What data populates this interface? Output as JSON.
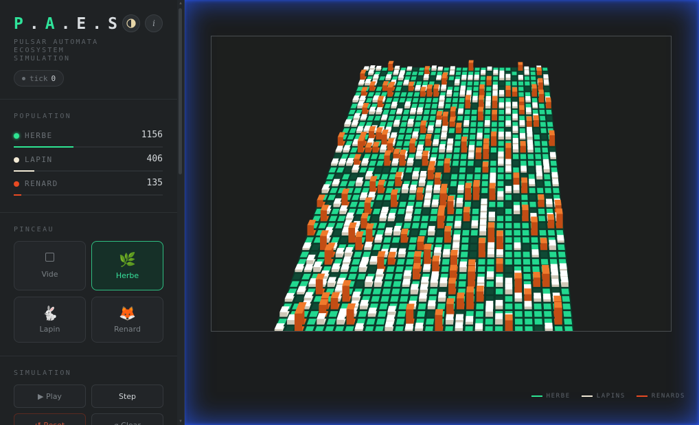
{
  "app": {
    "logo_p": "P",
    "logo_dot1": ".",
    "logo_a": "A",
    "logo_rest": ".E.S.",
    "subtitle": "PULSAR AUTOMATA ECOSYSTEM SIMULATION",
    "theme_icon": "half-moon-icon",
    "info_label": "i",
    "tick_label": "tick",
    "tick_value": "0"
  },
  "population": {
    "title": "POPULATION",
    "rows": [
      {
        "label": "HERBE",
        "value": "1156",
        "color": "#2ee592",
        "fill": 0.4
      },
      {
        "label": "LAPIN",
        "value": "406",
        "color": "#f2ead6",
        "fill": 0.14
      },
      {
        "label": "RENARD",
        "value": "135",
        "color": "#e84a22",
        "fill": 0.05
      }
    ]
  },
  "brush": {
    "title": "PINCEAU",
    "items": [
      {
        "label": "Vide",
        "icon": "square-icon",
        "active": false
      },
      {
        "label": "Herbe",
        "icon": "leaf-icon",
        "glyph": "🌿",
        "active": true
      },
      {
        "label": "Lapin",
        "icon": "rabbit-icon",
        "glyph": "🐇",
        "active": false
      },
      {
        "label": "Renard",
        "icon": "fox-icon",
        "glyph": "🦊",
        "active": false
      }
    ]
  },
  "simulation": {
    "title": "SIMULATION",
    "play_label": "▶ Play",
    "step_label": "Step",
    "reset_label": "↺ Reset",
    "clear_label": "⌀ Clear"
  },
  "legend": [
    {
      "label": "HERBE",
      "color": "#2ee592"
    },
    {
      "label": "LAPINS",
      "color": "#f2ead6"
    },
    {
      "label": "RENARDS",
      "color": "#e84a22"
    }
  ]
}
